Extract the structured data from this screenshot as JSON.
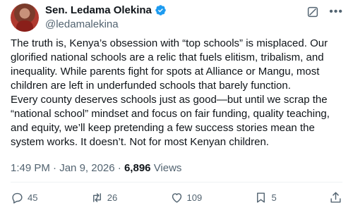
{
  "author": {
    "display_name": "Sen. Ledama Olekina",
    "handle": "@ledamalekina",
    "verified": true
  },
  "tweet": {
    "text": "The truth is, Kenya’s obsession with “top schools” is misplaced. Our glorified national schools are a relic that fuels elitism, tribalism, and inequality. While parents fight for spots at Alliance or Mangu, most children are left in underfunded schools that barely function.\nEvery county deserves schools just as good—but until we scrap the “national school” mindset and focus on fair funding, quality teaching, and equity, we’ll keep pretending a few success stories mean the system works. It doesn’t. Not for most Kenyan children.",
    "time": "1:49 PM",
    "separator": "·",
    "date": "Jan 9, 2026",
    "views_count": "6,896",
    "views_label": "Views"
  },
  "actions": {
    "replies": "45",
    "reposts": "26",
    "likes": "109",
    "bookmarks": "5"
  },
  "icons": {
    "verified": "verified-badge-icon",
    "grok": "grok-icon",
    "more": "more-icon",
    "reply": "reply-icon",
    "repost": "repost-icon",
    "like": "like-icon",
    "bookmark": "bookmark-icon",
    "share": "share-icon"
  },
  "colors": {
    "text": "#0f1419",
    "secondary": "#536471",
    "verified": "#1d9bf0",
    "divider": "#eff3f4"
  }
}
